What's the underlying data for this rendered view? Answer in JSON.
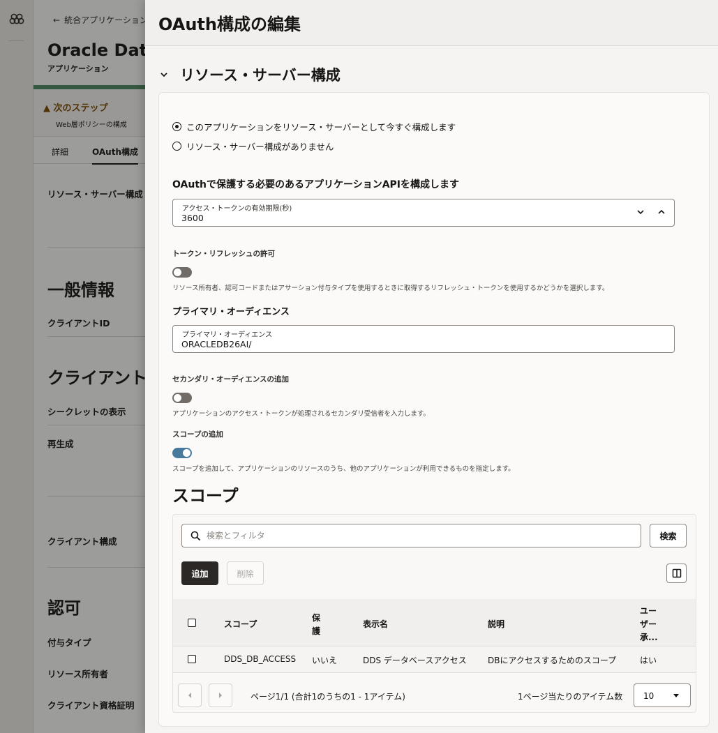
{
  "background": {
    "back_link": "統合アプリケーション",
    "title": "Oracle Data",
    "subtitle": "アプリケーション",
    "next_steps": {
      "heading": "次のステップ",
      "item": "Web層ポリシーの構成"
    },
    "tabs": [
      "詳細",
      "OAuth構成"
    ],
    "labels": {
      "resource_server_config": "リソース・サーバー構成",
      "general_info": "一般情報",
      "client_id": "クライアントID",
      "client": "クライアント",
      "show_secret": "シークレットの表示",
      "regenerate": "再生成",
      "client_config": "クライアント構成",
      "authorization": "認可",
      "grant_type": "付与タイプ",
      "resource_owner": "リソース所有者",
      "client_credentials": "クライアント資格証明"
    }
  },
  "drawer": {
    "title": "OAuth構成の編集",
    "section_title": "リソース・サーバー構成",
    "radio_configure_now": "このアプリケーションをリソース・サーバーとして今すぐ構成します",
    "radio_no_config": "リソース・サーバー構成がありません",
    "api_heading": "OAuthで保護する必要のあるアプリケーションAPIを構成します",
    "token_expiry": {
      "label": "アクセス・トークンの有効期限(秒)",
      "value": "3600"
    },
    "refresh": {
      "label": "トークン・リフレッシュの許可",
      "on": false,
      "hint": "リソース所有者、認可コードまたはアサーション付与タイプを使用するときに取得するリフレッシュ・トークンを使用するかどうかを選択します。"
    },
    "primary_audience": {
      "heading": "プライマリ・オーディエンス",
      "label": "プライマリ・オーディエンス",
      "value": "ORACLEDB26AI/"
    },
    "secondary_audience": {
      "label": "セカンダリ・オーディエンスの追加",
      "on": false,
      "hint": "アプリケーションのアクセス・トークンが処理されるセカンダリ受信者を入力します。"
    },
    "add_scope": {
      "label": "スコープの追加",
      "on": true,
      "hint": "スコープを追加して、アプリケーションのリソースのうち、他のアプリケーションが利用できるものを指定します。"
    },
    "scopes": {
      "heading": "スコープ",
      "search_placeholder": "検索とフィルタ",
      "search_button": "検索",
      "add_button": "追加",
      "delete_button": "削除",
      "columns": {
        "scope": "スコープ",
        "protected_1": "保",
        "protected_2": "護",
        "display_name": "表示名",
        "description": "説明",
        "user_consent_1": "ユー",
        "user_consent_2": "ザー",
        "user_consent_3": "承..."
      },
      "rows": [
        {
          "scope": "DDS_DB_ACCESS",
          "protected": "いいえ",
          "display_name": "DDS データベースアクセス",
          "description": "DBにアクセスするためのスコープ",
          "consent": "はい"
        }
      ],
      "pagination": "ページ1/1 (合計1のうちの1 - 1アイテム)",
      "per_page_label": "1ページ当たりのアイテム数",
      "per_page": "10"
    }
  }
}
